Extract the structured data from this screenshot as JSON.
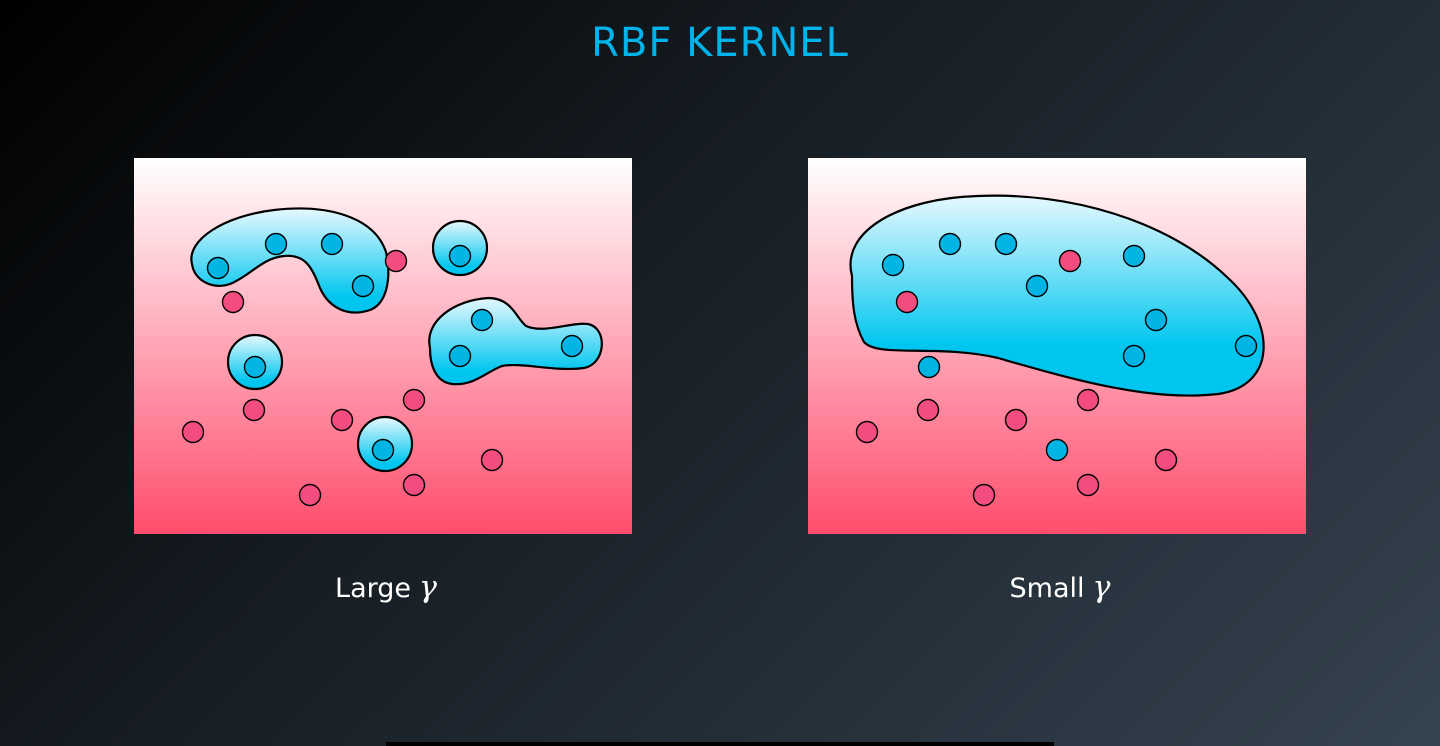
{
  "title": "RBF KERNEL",
  "colors": {
    "title": "#00b3ea",
    "label_text": "#ffffff",
    "panel_top": "#ffffff",
    "panel_bottom": "#ff4d6d",
    "region_top": "#e6f9ff",
    "region_bottom": "#00c6ef",
    "blue_point": "#00b4e4",
    "pink_point": "#f34c7e",
    "outline": "#000000"
  },
  "panels": [
    {
      "id": "large-gamma",
      "label": "Large",
      "gamma_symbol": "γ",
      "blue_points": [
        [
          84,
          110
        ],
        [
          142,
          86
        ],
        [
          198,
          86
        ],
        [
          229,
          128
        ],
        [
          326,
          98
        ],
        [
          348,
          162
        ],
        [
          438,
          188
        ],
        [
          326,
          198
        ],
        [
          121,
          209
        ],
        [
          249,
          292
        ]
      ],
      "pink_points": [
        [
          262,
          103
        ],
        [
          99,
          144
        ],
        [
          120,
          252
        ],
        [
          59,
          274
        ],
        [
          208,
          262
        ],
        [
          280,
          242
        ],
        [
          358,
          302
        ],
        [
          176,
          337
        ],
        [
          280,
          327
        ]
      ]
    },
    {
      "id": "small-gamma",
      "label": "Small",
      "gamma_symbol": "γ",
      "blue_points": [
        [
          85,
          107
        ],
        [
          142,
          86
        ],
        [
          198,
          86
        ],
        [
          229,
          128
        ],
        [
          326,
          98
        ],
        [
          348,
          162
        ],
        [
          438,
          188
        ],
        [
          326,
          198
        ],
        [
          121,
          209
        ],
        [
          249,
          292
        ]
      ],
      "pink_points": [
        [
          262,
          103
        ],
        [
          99,
          144
        ],
        [
          120,
          252
        ],
        [
          59,
          274
        ],
        [
          208,
          262
        ],
        [
          280,
          242
        ],
        [
          358,
          302
        ],
        [
          176,
          337
        ],
        [
          280,
          327
        ]
      ]
    }
  ]
}
